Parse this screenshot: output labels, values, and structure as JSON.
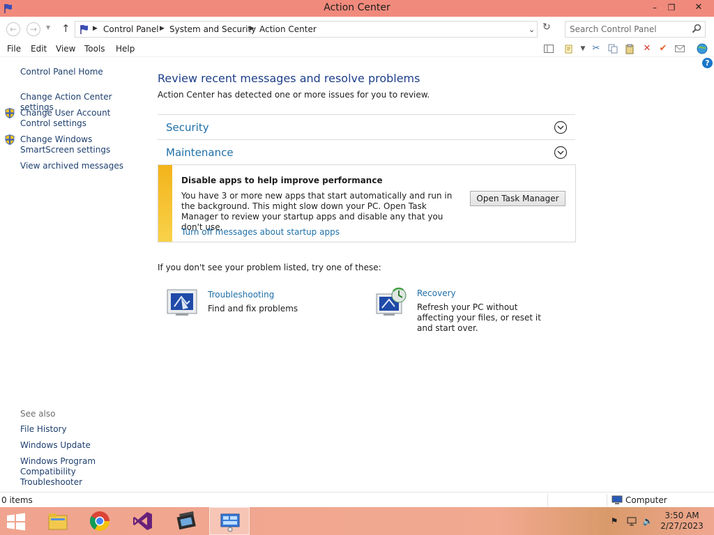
{
  "window": {
    "title": "Action Center",
    "controls": {
      "minimize": "–",
      "maximize": "❐",
      "close": "✕"
    }
  },
  "address": {
    "breadcrumbs": [
      "Control Panel",
      "System and Security",
      "Action Center"
    ],
    "search_placeholder": "Search Control Panel"
  },
  "menu": [
    "File",
    "Edit",
    "View",
    "Tools",
    "Help"
  ],
  "toolbar_icons": [
    "layout-icon",
    "properties-icon",
    "dropdown-icon",
    "cut-icon",
    "copy-icon",
    "paste-icon",
    "delete-icon",
    "check-icon",
    "mail-icon",
    "globe-icon"
  ],
  "sidebar": {
    "home": "Control Panel Home",
    "links": [
      {
        "label": "Change Action Center settings",
        "shield": false
      },
      {
        "label": "Change User Account Control settings",
        "shield": true
      },
      {
        "label": "Change Windows SmartScreen settings",
        "shield": true
      },
      {
        "label": "View archived messages",
        "shield": false
      }
    ],
    "see_also_title": "See also",
    "see_also": [
      "File History",
      "Windows Update",
      "Windows Program Compatibility Troubleshooter"
    ]
  },
  "main": {
    "title": "Review recent messages and resolve problems",
    "description": "Action Center has detected one or more issues for you to review.",
    "sections": [
      {
        "label": "Security"
      },
      {
        "label": "Maintenance"
      }
    ],
    "message": {
      "title": "Disable apps to help improve performance",
      "body": "You have 3 or more new apps that start automatically and run in the background. This might slow down your PC. Open Task Manager to review your startup apps and disable any that you don't use.",
      "link": "Turn off messages about startup apps",
      "button": "Open Task Manager",
      "accent_color": "#f3b31b"
    },
    "hint": "If you don't see your problem listed, try one of these:",
    "tools": [
      {
        "link": "Troubleshooting",
        "desc": "Find and fix problems",
        "icon": "troubleshooting-icon"
      },
      {
        "link": "Recovery",
        "desc": "Refresh your PC without affecting your files, or reset it and start over.",
        "icon": "recovery-icon"
      }
    ]
  },
  "status": {
    "items": "0 items",
    "location": "Computer"
  },
  "taskbar": {
    "apps": [
      "file-explorer-icon",
      "chrome-icon",
      "visual-studio-icon",
      "movie-maker-icon",
      "control-panel-icon"
    ],
    "time": "3:50 AM",
    "date": "2/27/2023"
  },
  "colors": {
    "titlebar": "#f08a7c",
    "link": "#1e6fa8",
    "heading": "#1e3f8a"
  }
}
